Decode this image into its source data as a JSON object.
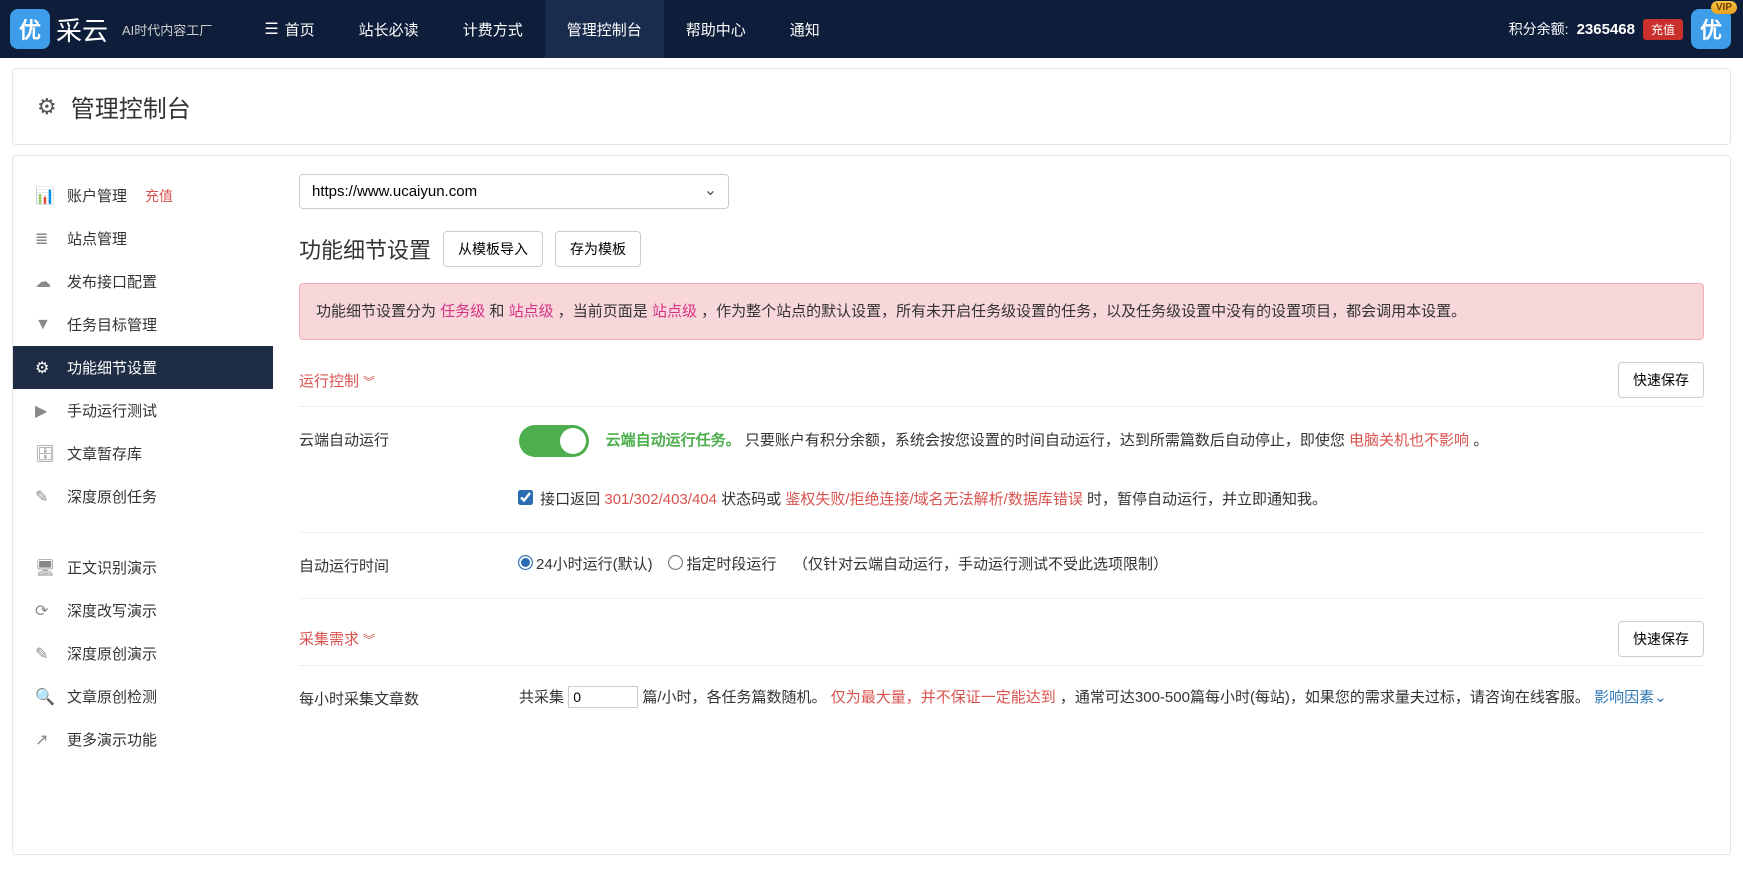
{
  "header": {
    "logo_text": "采云",
    "logo_char": "优",
    "tagline": "AI时代内容工厂",
    "nav": [
      {
        "label": "首页",
        "icon": "☰"
      },
      {
        "label": "站长必读"
      },
      {
        "label": "计费方式"
      },
      {
        "label": "管理控制台"
      },
      {
        "label": "帮助中心"
      },
      {
        "label": "通知"
      }
    ],
    "points_label": "积分余额:",
    "points_value": "2365468",
    "recharge": "充值",
    "vip": "VIP",
    "avatar_char": "优"
  },
  "page_title": "管理控制台",
  "sidebar": {
    "items": [
      {
        "label": "账户管理",
        "icon": "chart"
      },
      {
        "label": "站点管理",
        "icon": "list"
      },
      {
        "label": "发布接口配置",
        "icon": "cloud"
      },
      {
        "label": "任务目标管理",
        "icon": "filter"
      },
      {
        "label": "功能细节设置",
        "icon": "cogs"
      },
      {
        "label": "手动运行测试",
        "icon": "play"
      },
      {
        "label": "文章暂存库",
        "icon": "db"
      },
      {
        "label": "深度原创任务",
        "icon": "edit"
      }
    ],
    "recharge_badge": "充值",
    "items2": [
      {
        "label": "正文识别演示",
        "icon": "desktop"
      },
      {
        "label": "深度改写演示",
        "icon": "refresh"
      },
      {
        "label": "深度原创演示",
        "icon": "edit"
      },
      {
        "label": "文章原创检测",
        "icon": "search"
      },
      {
        "label": "更多演示功能",
        "icon": "share"
      }
    ]
  },
  "main": {
    "site_url": "https://www.ucaiyun.com",
    "section_title": "功能细节设置",
    "btn_import": "从模板导入",
    "btn_save_tpl": "存为模板",
    "alert": {
      "p1": "功能细节设置分为",
      "task_level": "任务级",
      "and": "和",
      "site_level": "站点级",
      "p2": "，当前页面是",
      "site_level2": "站点级",
      "p3": "，作为整个站点的默认设置，所有未开启任务级设置的任务，以及任务级设置中没有的设置项目，都会调用本设置。"
    },
    "panel1": {
      "title": "运行控制",
      "quick_save": "快速保存"
    },
    "row1": {
      "label": "云端自动运行",
      "t1": "云端自动运行任务。",
      "t2": "只要账户有积分余额，系统会按您设置的时间自动运行，达到所需篇数后自动停止，即使您",
      "t3": "电脑关机也不影响",
      "t4": "。",
      "chk1": "接口返回",
      "codes": "301/302/403/404",
      "chk2": "状态码或",
      "errs": "鉴权失败/拒绝连接/域名无法解析/数据库错误",
      "chk3": "时，暂停自动运行，并立即通知我。"
    },
    "row2": {
      "label": "自动运行时间",
      "opt1": "24小时运行(默认)",
      "opt2": "指定时段运行",
      "note": "（仅针对云端自动运行，手动运行测试不受此选项限制）"
    },
    "panel2": {
      "title": "采集需求",
      "quick_save": "快速保存"
    },
    "row3": {
      "label": "每小时采集文章数",
      "p1": "共采集",
      "value": "0",
      "p2": "篇/小时，各任务篇数随机。",
      "warn": "仅为最大量，并不保证一定能达到",
      "p3": "，通常可达300-500篇每小时(每站)，如果您的需求量夫过标，请咨询在线客服。",
      "link": "影响因素"
    }
  },
  "icons": {
    "chart": "📊",
    "list": "≣",
    "cloud": "☁",
    "filter": "▼",
    "cogs": "⚙",
    "play": "▶",
    "db": "🗄",
    "edit": "✎",
    "desktop": "🖥",
    "refresh": "⟳",
    "search": "🔍",
    "share": "↗"
  }
}
